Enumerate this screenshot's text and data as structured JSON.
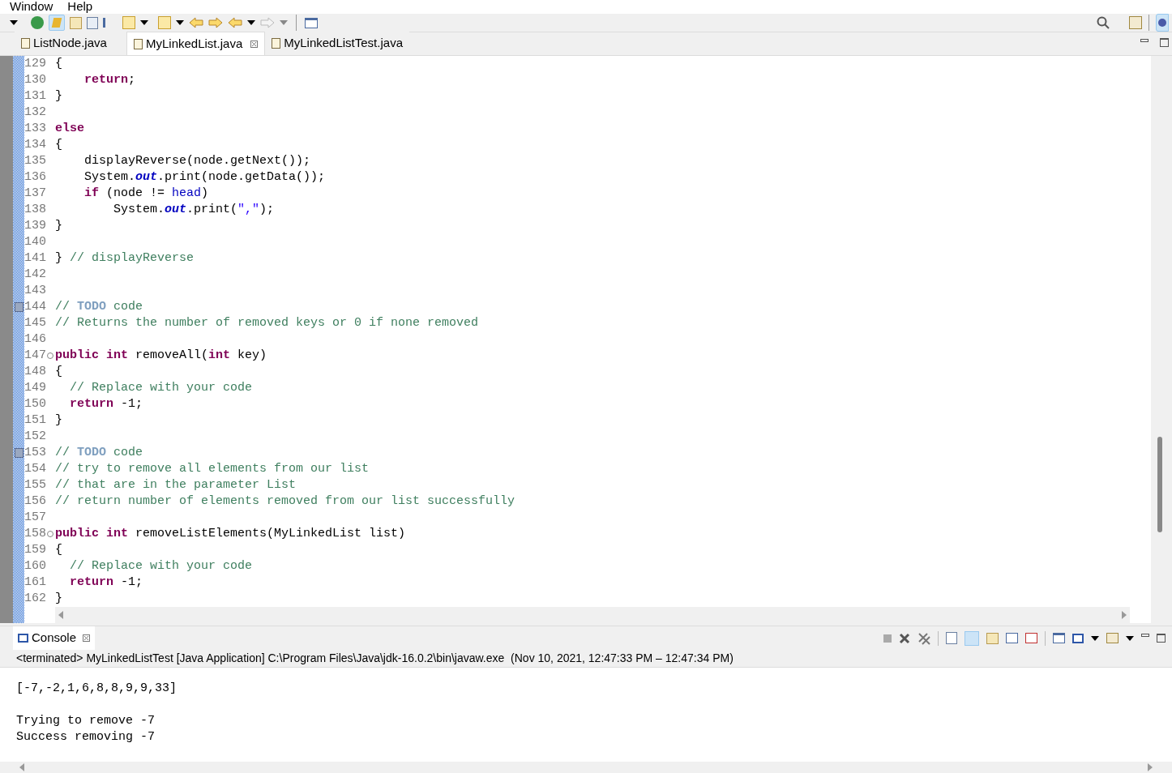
{
  "menu": [
    "Window",
    "Help"
  ],
  "editor_tabs": [
    {
      "label": "ListNode.java",
      "selected": false,
      "closable": false
    },
    {
      "label": "MyLinkedList.java",
      "selected": true,
      "closable": true
    },
    {
      "label": "MyLinkedListTest.java",
      "selected": false,
      "closable": false
    }
  ],
  "code_lines": [
    {
      "number": "129",
      "tokens": [
        {
          "kind": "plain",
          "text": "{"
        }
      ]
    },
    {
      "number": "130",
      "tokens": [
        {
          "kind": "keyword",
          "text": "    return"
        },
        {
          "kind": "plain",
          "text": ";"
        }
      ]
    },
    {
      "number": "131",
      "tokens": [
        {
          "kind": "plain",
          "text": "}"
        }
      ]
    },
    {
      "number": "132"
    },
    {
      "number": "133",
      "tokens": [
        {
          "kind": "keyword",
          "text": "else"
        }
      ]
    },
    {
      "number": "134",
      "tokens": [
        {
          "kind": "plain",
          "text": "{"
        }
      ]
    },
    {
      "number": "135",
      "tokens": [
        {
          "kind": "plain",
          "text": "    displayReverse(node.getNext());"
        }
      ]
    },
    {
      "number": "136",
      "tokens": [
        {
          "kind": "plain",
          "text": "    System."
        },
        {
          "kind": "static",
          "text": "out"
        },
        {
          "kind": "plain",
          "text": ".print(node.getData());"
        }
      ]
    },
    {
      "number": "137",
      "tokens": [
        {
          "kind": "keyword",
          "text": "    if"
        },
        {
          "kind": "plain",
          "text": " (node != "
        },
        {
          "kind": "field",
          "text": "head"
        },
        {
          "kind": "plain",
          "text": ")"
        }
      ]
    },
    {
      "number": "138",
      "tokens": [
        {
          "kind": "plain",
          "text": "        System."
        },
        {
          "kind": "static",
          "text": "out"
        },
        {
          "kind": "plain",
          "text": ".print("
        },
        {
          "kind": "string",
          "text": "\",\""
        },
        {
          "kind": "plain",
          "text": ");"
        }
      ]
    },
    {
      "number": "139",
      "tokens": [
        {
          "kind": "plain",
          "text": "}"
        }
      ]
    },
    {
      "number": "140"
    },
    {
      "number": "141",
      "tokens": [
        {
          "kind": "plain",
          "text": "} "
        },
        {
          "kind": "comment",
          "text": "// displayReverse"
        }
      ]
    },
    {
      "number": "142"
    },
    {
      "number": "143"
    },
    {
      "number": "144",
      "task": true,
      "tokens": [
        {
          "kind": "comment",
          "text": "// "
        },
        {
          "kind": "todo",
          "text": "TODO"
        },
        {
          "kind": "comment",
          "text": " code"
        }
      ]
    },
    {
      "number": "145",
      "tokens": [
        {
          "kind": "comment",
          "text": "// Returns the number of removed keys or 0 if none removed"
        }
      ]
    },
    {
      "number": "146"
    },
    {
      "number": "147",
      "fold": true,
      "tokens": [
        {
          "kind": "keyword",
          "text": "public int"
        },
        {
          "kind": "plain",
          "text": " removeAll("
        },
        {
          "kind": "keyword",
          "text": "int"
        },
        {
          "kind": "plain",
          "text": " key)"
        }
      ]
    },
    {
      "number": "148",
      "tokens": [
        {
          "kind": "plain",
          "text": "{"
        }
      ]
    },
    {
      "number": "149",
      "tokens": [
        {
          "kind": "comment",
          "text": "  // Replace with your code"
        }
      ]
    },
    {
      "number": "150",
      "tokens": [
        {
          "kind": "keyword",
          "text": "  return"
        },
        {
          "kind": "plain",
          "text": " -1;"
        }
      ]
    },
    {
      "number": "151",
      "tokens": [
        {
          "kind": "plain",
          "text": "}"
        }
      ]
    },
    {
      "number": "152"
    },
    {
      "number": "153",
      "task": true,
      "tokens": [
        {
          "kind": "comment",
          "text": "// "
        },
        {
          "kind": "todo",
          "text": "TODO"
        },
        {
          "kind": "comment",
          "text": " code"
        }
      ]
    },
    {
      "number": "154",
      "tokens": [
        {
          "kind": "comment",
          "text": "// try to remove all elements from our list"
        }
      ]
    },
    {
      "number": "155",
      "tokens": [
        {
          "kind": "comment",
          "text": "// that are in the parameter List"
        }
      ]
    },
    {
      "number": "156",
      "tokens": [
        {
          "kind": "comment",
          "text": "// return number of elements removed from our list successfully"
        }
      ]
    },
    {
      "number": "157"
    },
    {
      "number": "158",
      "fold": true,
      "tokens": [
        {
          "kind": "keyword",
          "text": "public int"
        },
        {
          "kind": "plain",
          "text": " removeListElements(MyLinkedList list)"
        }
      ]
    },
    {
      "number": "159",
      "tokens": [
        {
          "kind": "plain",
          "text": "{"
        }
      ]
    },
    {
      "number": "160",
      "tokens": [
        {
          "kind": "comment",
          "text": "  // Replace with your code"
        }
      ]
    },
    {
      "number": "161",
      "tokens": [
        {
          "kind": "keyword",
          "text": "  return"
        },
        {
          "kind": "plain",
          "text": " -1;"
        }
      ]
    },
    {
      "number": "162",
      "tokens": [
        {
          "kind": "plain",
          "text": "}"
        }
      ]
    }
  ],
  "console": {
    "tab": "Console",
    "status": "<terminated> MyLinkedListTest [Java Application] C:\\Program Files\\Java\\jdk-16.0.2\\bin\\javaw.exe  (Nov 10, 2021, 12:47:33 PM – 12:47:34 PM)",
    "output_blocks": [
      [
        "[-7,-2,1,6,8,8,9,9,33]"
      ],
      [
        "Trying to remove -7",
        "Success removing -7"
      ]
    ]
  }
}
